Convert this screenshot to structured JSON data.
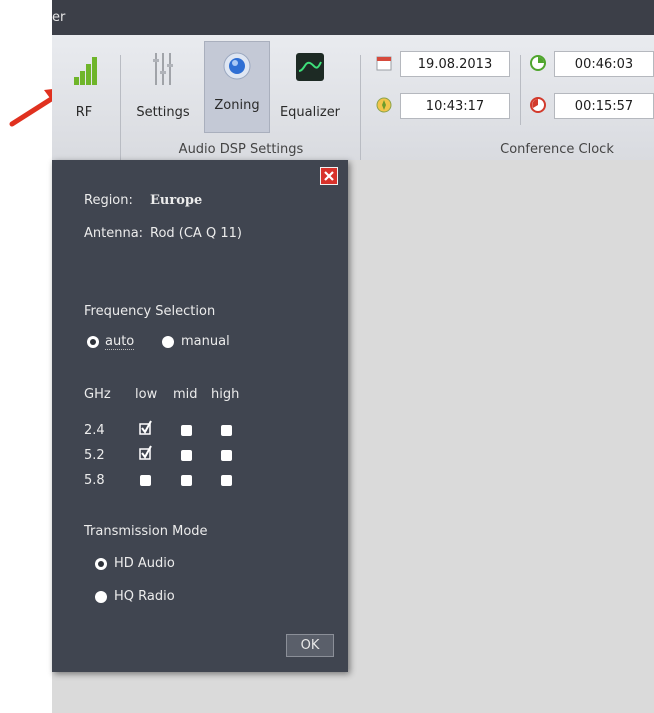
{
  "window": {
    "title_fragment": "er"
  },
  "ribbon": {
    "rf_label": "RF",
    "settings_label": "Settings",
    "zoning_label": "Zoning",
    "equalizer_label": "Equalizer",
    "audio_group_label": "Audio DSP Settings",
    "clock_group_label": "Conference Clock",
    "date": "19.08.2013",
    "time": "10:43:17",
    "timer_elapsed": "00:46:03",
    "timer_remaining": "00:15:57"
  },
  "dialog": {
    "region_label": "Region:",
    "region_value": "Europe",
    "antenna_label": "Antenna:",
    "antenna_value": "Rod (CA Q 11)",
    "freq_heading": "Frequency Selection",
    "freq_options": [
      "auto",
      "manual"
    ],
    "freq_selected": "auto",
    "table": {
      "headers": [
        "GHz",
        "low",
        "mid",
        "high"
      ],
      "rows": [
        {
          "ghz": "2.4",
          "low": true,
          "mid": false,
          "high": false
        },
        {
          "ghz": "5.2",
          "low": true,
          "mid": false,
          "high": false
        },
        {
          "ghz": "5.8",
          "low": false,
          "mid": false,
          "high": false
        }
      ]
    },
    "mode_heading": "Transmission Mode",
    "mode_options": [
      "HD Audio",
      "HQ Radio"
    ],
    "mode_selected": "HD Audio",
    "ok_label": "OK"
  },
  "colors": {
    "dialog_bg": "#404550",
    "titlebar_bg": "#3c3f48",
    "close_red": "#d8322b",
    "annotation_arrow": "#e0311f"
  }
}
